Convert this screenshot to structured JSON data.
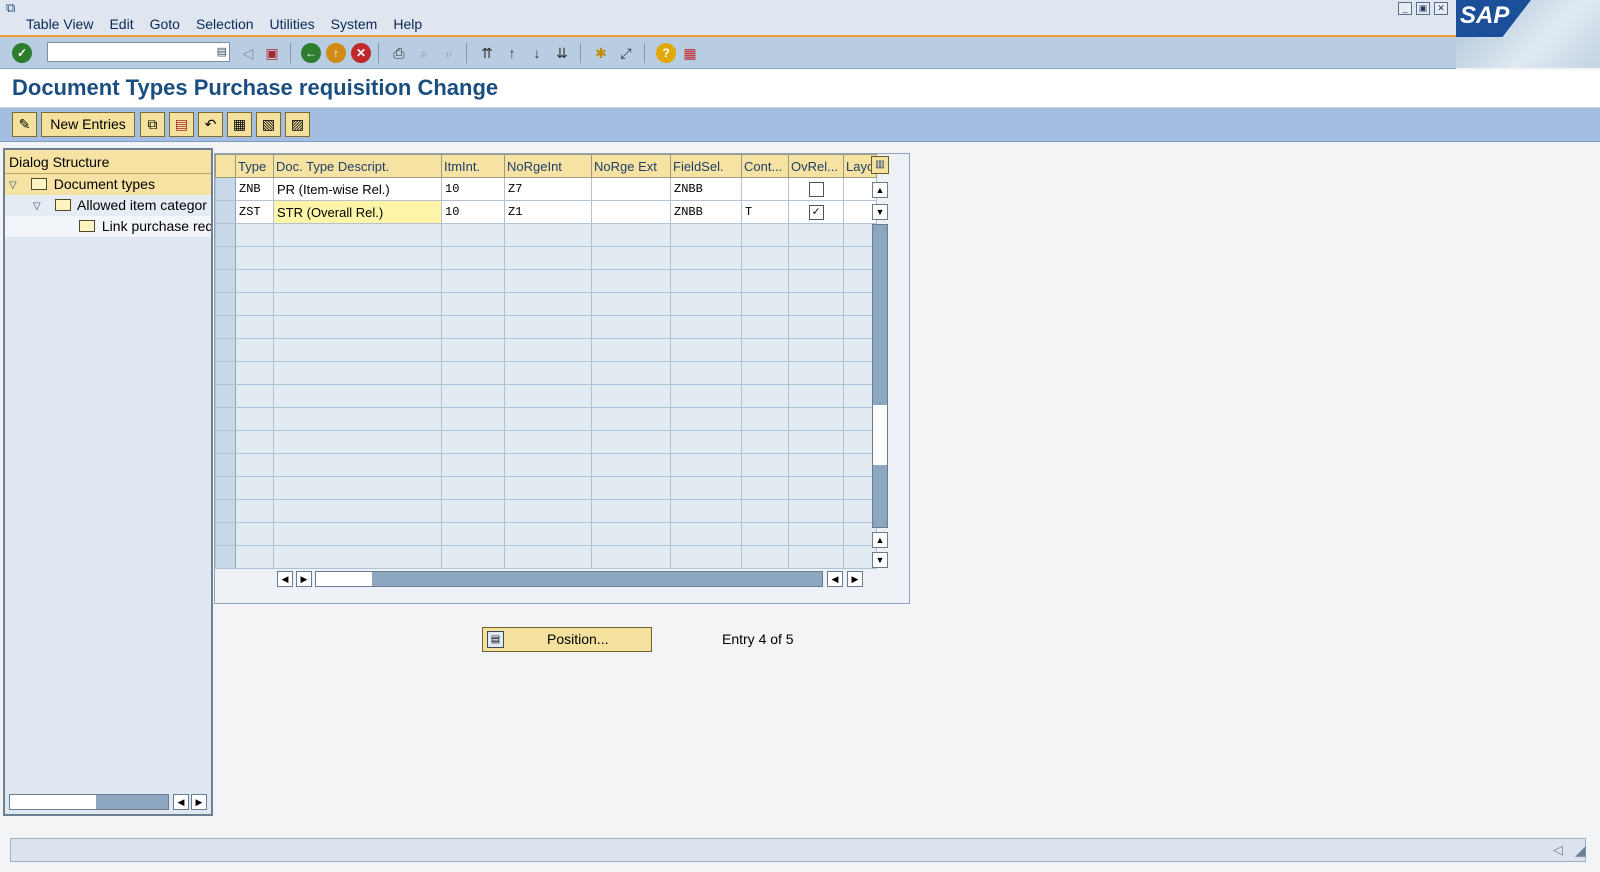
{
  "menu": [
    "Table View",
    "Edit",
    "Goto",
    "Selection",
    "Utilities",
    "System",
    "Help"
  ],
  "brand": "SAP",
  "command_field": {
    "value": ""
  },
  "title": "Document Types Purchase requisition Change",
  "app_toolbar": {
    "new_entries": "New Entries"
  },
  "nav": {
    "header": "Dialog Structure",
    "items": [
      {
        "label": "Document types"
      },
      {
        "label": "Allowed item categor"
      },
      {
        "label": "Link purchase req"
      }
    ]
  },
  "table": {
    "columns": [
      "Type",
      "Doc. Type Descript.",
      "ItmInt.",
      "NoRgeInt",
      "NoRge Ext",
      "FieldSel.",
      "Cont...",
      "OvRel...",
      "Layo"
    ],
    "rows": [
      {
        "type": "ZNB",
        "descr": "PR (Item-wise Rel.)",
        "itmint": "10",
        "norgeint": "Z7",
        "norgeext": "",
        "fieldsel": "ZNBB",
        "cont": "",
        "ovrel": false,
        "layo": ""
      },
      {
        "type": "ZST",
        "descr": "STR (Overall Rel.)",
        "itmint": "10",
        "norgeint": "Z1",
        "norgeext": "",
        "fieldsel": "ZNBB",
        "cont": "T",
        "ovrel": true,
        "layo": ""
      }
    ],
    "empty_rows": 15
  },
  "position_button": "Position...",
  "entry_info": "Entry 4 of 5",
  "colors": {
    "accent": "#f29b3b",
    "title": "#1b4e80",
    "button": "#f4e19d",
    "toolbar": "#b9cde2"
  }
}
